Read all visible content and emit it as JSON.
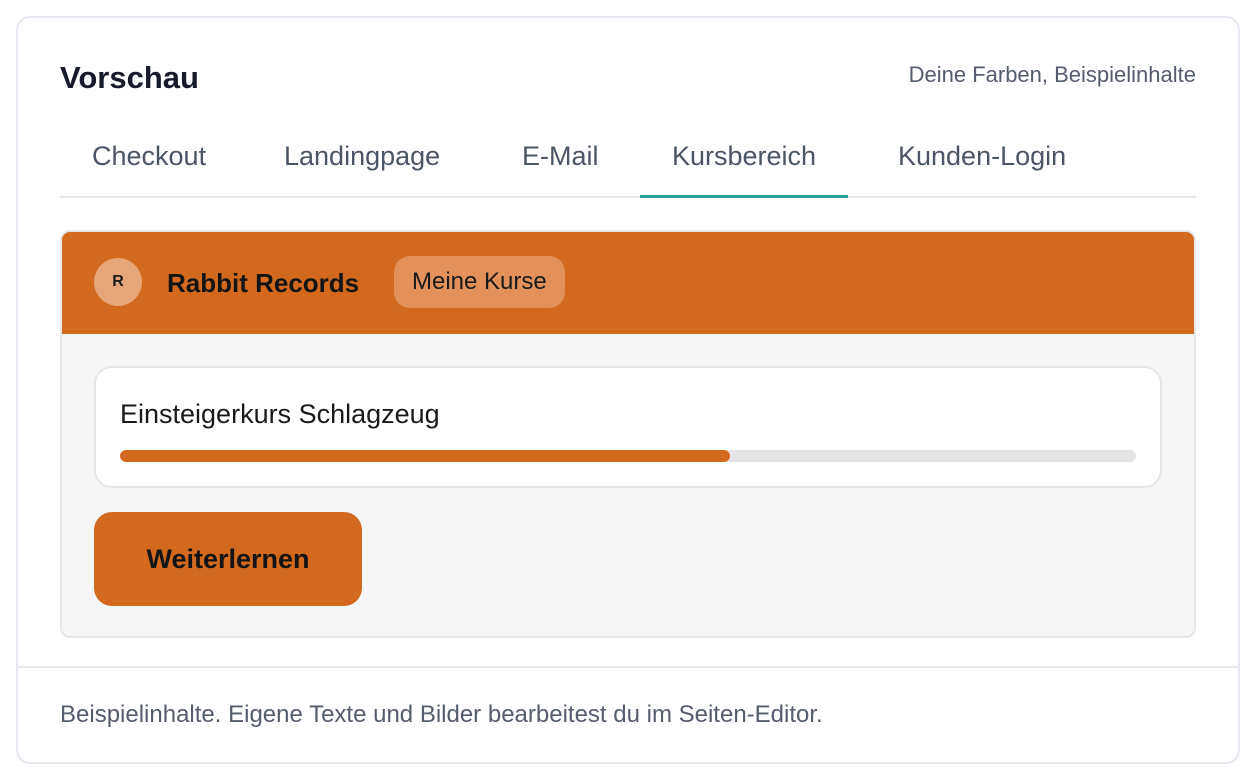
{
  "header": {
    "title": "Vorschau",
    "subtitle": "Deine Farben, Beispielinhalte"
  },
  "tabs": [
    {
      "label": "Checkout",
      "active": false
    },
    {
      "label": "Landingpage",
      "active": false
    },
    {
      "label": "E-Mail",
      "active": false
    },
    {
      "label": "Kursbereich",
      "active": true
    },
    {
      "label": "Kunden-Login",
      "active": false
    }
  ],
  "preview": {
    "appbar": {
      "avatar_letter": "R",
      "brand_name": "Rabbit Records",
      "nav_chip": "Meine Kurse"
    },
    "course": {
      "title": "Einsteigerkurs Schlagzeug",
      "progress": 0.6
    },
    "cta_label": "Weiterlernen"
  },
  "footer": {
    "note": "Beispielinhalte. Eigene Texte und Bilder bearbeitest du im Seiten-Editor."
  },
  "colors": {
    "accent": "#d2691e",
    "tab_indicator": "#2aa198",
    "text_dark": "#161a2b",
    "text_muted": "#555c6e"
  }
}
